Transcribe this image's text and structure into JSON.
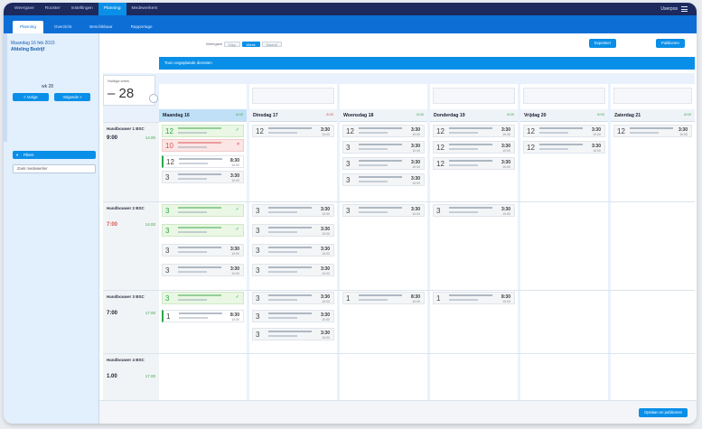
{
  "topnav": [
    "Weergave",
    "Rooster",
    "Instellingen",
    "Planning",
    "Medewerkers"
  ],
  "account": "Userpos",
  "subnav": [
    "Planning",
    "Overzicht",
    "Beschikbaar",
    "Rapportage"
  ],
  "sidebar": {
    "date_line1": "Maandag 16 feb 2015",
    "date_line2": "Afdeling Bedrijf",
    "week_label": "wk 28",
    "btn_prev": "< Vorige",
    "btn_next": "Volgende >",
    "filter_label": "Filters",
    "search_placeholder": "Zoek medewerker"
  },
  "viewbar": {
    "label": "Weergave",
    "options": [
      "Dag",
      "Week",
      "Maand"
    ]
  },
  "toolbar": {
    "btn1": "Exporteer",
    "btn2": "Publiceren"
  },
  "banner": "Toon ongeplande diensten",
  "week": {
    "label": "Huidige week",
    "number": "28"
  },
  "days": [
    {
      "name": "Maandag",
      "date": "16",
      "hours": "8:00"
    },
    {
      "name": "Dinsdag",
      "date": "17",
      "hours": "8:00"
    },
    {
      "name": "Woensdag",
      "date": "18",
      "hours": "8:00"
    },
    {
      "name": "Donderdag",
      "date": "19",
      "hours": "8:00"
    },
    {
      "name": "Vrijdag",
      "date": "20",
      "hours": "8:00"
    },
    {
      "name": "Zaterdag",
      "date": "21",
      "hours": "8:00"
    }
  ],
  "rows": [
    {
      "name": "Handbouwer 1 BSC",
      "time": "9:00",
      "green": "14.00"
    },
    {
      "name": "Handbouwer 2 BSC",
      "time": "7:00",
      "green": "14.00"
    },
    {
      "name": "Handbouwer 3 BSC",
      "time": "7:00",
      "green": "17.00"
    },
    {
      "name": "Handbouwer 4 BSC",
      "time": "1.00",
      "green": "17.00"
    }
  ],
  "bottom_btn": "Opslaan en publiceren"
}
